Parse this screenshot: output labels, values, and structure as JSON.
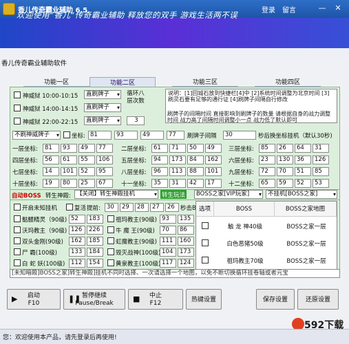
{
  "window": {
    "title": "香儿传奇霸业辅助 6.5",
    "login": "登录",
    "logout": "留言",
    "minimize": "—",
    "close": "✕"
  },
  "banner": {
    "text": "欢迎使用“香儿”传奇霸业辅助 释放您的双手 游戏生活两不误"
  },
  "app": {
    "header_tab": "香儿传奇霸业辅助软件"
  },
  "tabs": [
    "功能一区",
    "功能二区",
    "功能三区",
    "功能四区"
  ],
  "timed": [
    {
      "label": "神威狱 10:00-10:15",
      "mode": "直刷牌子"
    },
    {
      "label": "神威狱 14:00-14:15",
      "mode": "直刷牌子"
    },
    {
      "label": "神威狱 22:00-22:15",
      "mode": "直刷牌子"
    }
  ],
  "loop": {
    "label": "循环八层次数",
    "value": "3"
  },
  "info": {
    "text": "说明：[1]回城石放到快捷栏[4]中 [2]系统时间调整为北京时间 [3]刷灵石要有足够的通行证 [4]刷牌子间隔自行修改",
    "text2": "刷牌子的间隔时间 直接影响到刷牌子的数量 请根据自身的战力调整时间 战力高了间隔时间调整小一点 战力低了默认即可"
  },
  "coord_row": {
    "mode": "不刷神威牌子",
    "coord_label": "坐标:",
    "x": "81",
    "y": "93",
    "x2": "49",
    "y2": "77",
    "interval_label": "刷牌子间隔",
    "interval": "30",
    "hang_label": "秒后换坐标挂机（默认30秒)"
  },
  "layers": [
    {
      "label": "一层坐标:",
      "a": "81",
      "b": "93",
      "c": "49",
      "d": "77"
    },
    {
      "label": "二层坐标:",
      "a": "61",
      "b": "71",
      "c": "50",
      "d": "49"
    },
    {
      "label": "三层坐标:",
      "a": "85",
      "b": "26",
      "c": "64",
      "d": "31"
    },
    {
      "label": "四层坐标:",
      "a": "56",
      "b": "61",
      "c": "55",
      "d": "106"
    },
    {
      "label": "五层坐标:",
      "a": "94",
      "b": "173",
      "c": "84",
      "d": "162"
    },
    {
      "label": "六层坐标:",
      "a": "23",
      "b": "130",
      "c": "36",
      "d": "126"
    },
    {
      "label": "七层坐标:",
      "a": "14",
      "b": "101",
      "c": "52",
      "d": "95"
    },
    {
      "label": "八层坐标:",
      "a": "96",
      "b": "113",
      "c": "88",
      "d": "101"
    },
    {
      "label": "九层坐标:",
      "a": "72",
      "b": "70",
      "c": "51",
      "d": "85"
    },
    {
      "label": "十层坐标:",
      "a": "19",
      "b": "80",
      "c": "25",
      "d": "67"
    },
    {
      "label": "十一坐标:",
      "a": "35",
      "b": "31",
      "c": "42",
      "d": "17"
    },
    {
      "label": "十二坐标:",
      "a": "65",
      "b": "59",
      "c": "52",
      "d": "53"
    }
  ],
  "boss_bar": {
    "label": "自动BOSS",
    "reborn": "转生神殿:",
    "close_tag": "【关闭】转生神殿挂机",
    "play": "转生玩法",
    "boss_home": "BOSS之家[VIP玩家]",
    "not_hang": "不挂机[BOSS之家]"
  },
  "boss_opts": {
    "auto_revive": "开启未知挂机",
    "revive": "复活",
    "advance": "提前:",
    "t1": "30",
    "t2": "29",
    "t3": "28",
    "t4": "27",
    "t5": "26",
    "refresh": "秒击BOSS点"
  },
  "boss_list": [
    {
      "name": "骷髅精灵（90级)",
      "a": "52",
      "b": "183",
      "name2": "祖玛教主(90级)",
      "c": "93",
      "d": "135"
    },
    {
      "name": "沃玛教主（90级)",
      "a": "126",
      "b": "226",
      "name2": "牛 魔 王(90级)",
      "c": "70",
      "d": "86"
    },
    {
      "name": "双头金刚(90级)",
      "a": "162",
      "b": "185",
      "name2": "虹魔教主(90级)",
      "c": "111",
      "d": "160"
    },
    {
      "name": "尸 霸(100级)",
      "a": "133",
      "b": "184",
      "name2": "毁灭战神(100级)",
      "c": "104",
      "d": "173"
    },
    {
      "name": "白 蛇 妖(100级)",
      "a": "112",
      "b": "154",
      "name2": "黄泉教主(100级)",
      "c": "117",
      "d": "124"
    }
  ],
  "boss_table": {
    "h1": "选项",
    "h2": "BOSS",
    "h3": "BOSS之家地图",
    "rows": [
      {
        "boss": "触 龙 神40级",
        "map": "BOSS之家一层"
      },
      {
        "boss": "白色恶猪50级",
        "map": "BOSS之家一层"
      },
      {
        "boss": "祖玛教主70级",
        "map": "BOSS之家一层"
      }
    ]
  },
  "scroll_note": "[未知暗殿]BOSS之家]转生神殿]挂机不同时选择、一次请选择一个地图，以免不断切换循环挂卷轴或者元宝",
  "buttons": {
    "start": "启动",
    "start_key": "F10",
    "pause": "暂停继续",
    "pause_key": "Pause/Break",
    "stop": "中止",
    "stop_key": "F12",
    "hotkey": "热键设置",
    "save": "保存设置",
    "restore": "还原设置"
  },
  "status": "您：欢迎使用本产品，请先登录后再使用!",
  "watermark": "592下载"
}
